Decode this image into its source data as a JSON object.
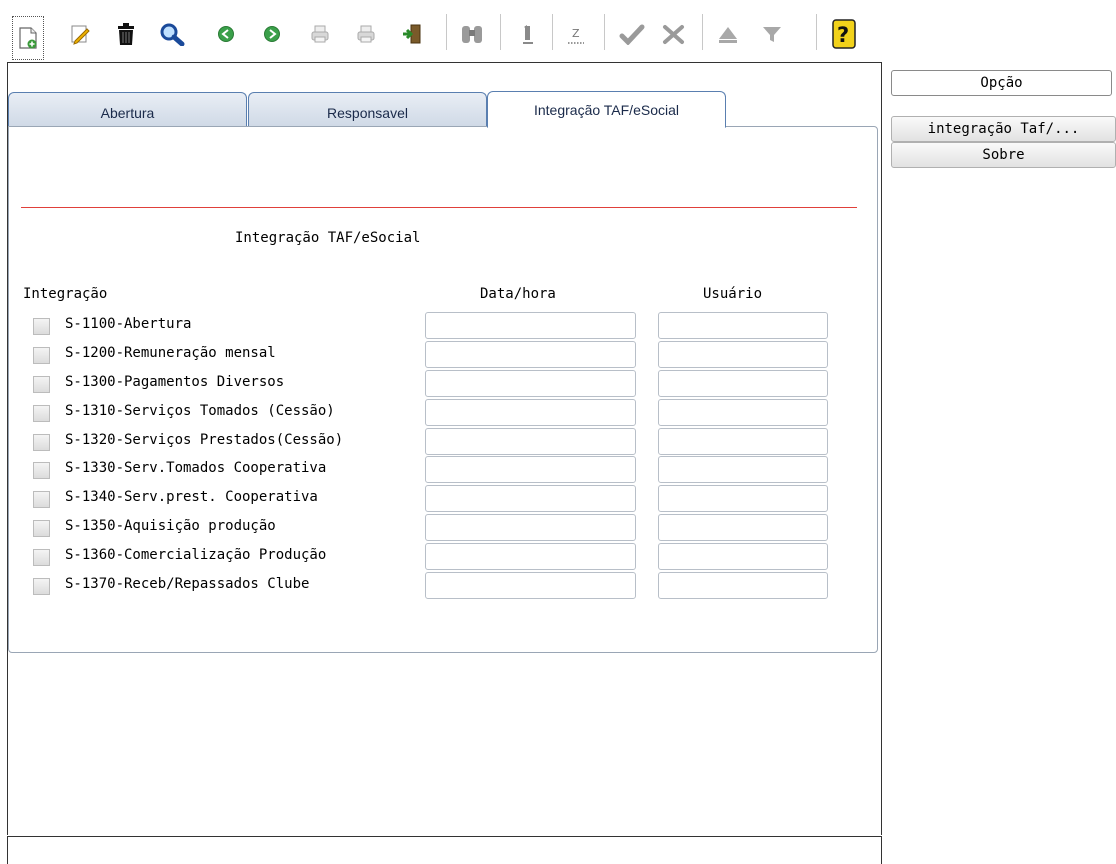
{
  "toolbar": {
    "buttons": [
      {
        "icon": "new-document-icon"
      },
      {
        "icon": "edit-pencil-icon"
      },
      {
        "icon": "trash-icon"
      },
      {
        "icon": "search-icon"
      },
      {
        "icon": "previous-icon"
      },
      {
        "icon": "next-icon"
      },
      {
        "icon": "print-icon"
      },
      {
        "icon": "print-preview-icon"
      },
      {
        "icon": "exit-icon"
      },
      {
        "icon": "binoculars-icon"
      },
      {
        "icon": "first-record-icon"
      },
      {
        "icon": "last-record-icon"
      },
      {
        "icon": "confirm-check-icon"
      },
      {
        "icon": "cancel-icon"
      },
      {
        "icon": "move-up-icon"
      },
      {
        "icon": "filter-icon"
      },
      {
        "icon": "help-icon"
      }
    ]
  },
  "tabs": [
    {
      "label": "Abertura",
      "active": false
    },
    {
      "label": "Responsavel",
      "active": false
    },
    {
      "label": "Integração TAF/eSocial",
      "active": true
    }
  ],
  "panel": {
    "title": "Integração TAF/eSocial",
    "columns": {
      "integracao": "Integração",
      "data_hora": "Data/hora",
      "usuario": "Usuário"
    },
    "rows": [
      {
        "label": "S-1100-Abertura",
        "checked": false,
        "data_hora": "",
        "usuario": ""
      },
      {
        "label": "S-1200-Remuneração mensal",
        "checked": false,
        "data_hora": "",
        "usuario": ""
      },
      {
        "label": "S-1300-Pagamentos Diversos",
        "checked": false,
        "data_hora": "",
        "usuario": ""
      },
      {
        "label": "S-1310-Serviços Tomados (Cessão)",
        "checked": false,
        "data_hora": "",
        "usuario": ""
      },
      {
        "label": "S-1320-Serviços Prestados(Cessão)",
        "checked": false,
        "data_hora": "",
        "usuario": ""
      },
      {
        "label": "S-1330-Serv.Tomados Cooperativa",
        "checked": false,
        "data_hora": "",
        "usuario": ""
      },
      {
        "label": "S-1340-Serv.prest. Cooperativa",
        "checked": false,
        "data_hora": "",
        "usuario": ""
      },
      {
        "label": "S-1350-Aquisição produção",
        "checked": false,
        "data_hora": "",
        "usuario": ""
      },
      {
        "label": "S-1360-Comercialização Produção",
        "checked": false,
        "data_hora": "",
        "usuario": ""
      },
      {
        "label": "S-1370-Receb/Repassados Clube",
        "checked": false,
        "data_hora": "",
        "usuario": ""
      }
    ]
  },
  "side_menu": {
    "header": "Opção",
    "items": [
      {
        "label": "integração Taf/..."
      },
      {
        "label": "Sobre"
      }
    ]
  },
  "colors": {
    "tab_border": "#5a7fb0",
    "separator_line": "#e0403a",
    "help_yellow": "#f2d21a"
  }
}
